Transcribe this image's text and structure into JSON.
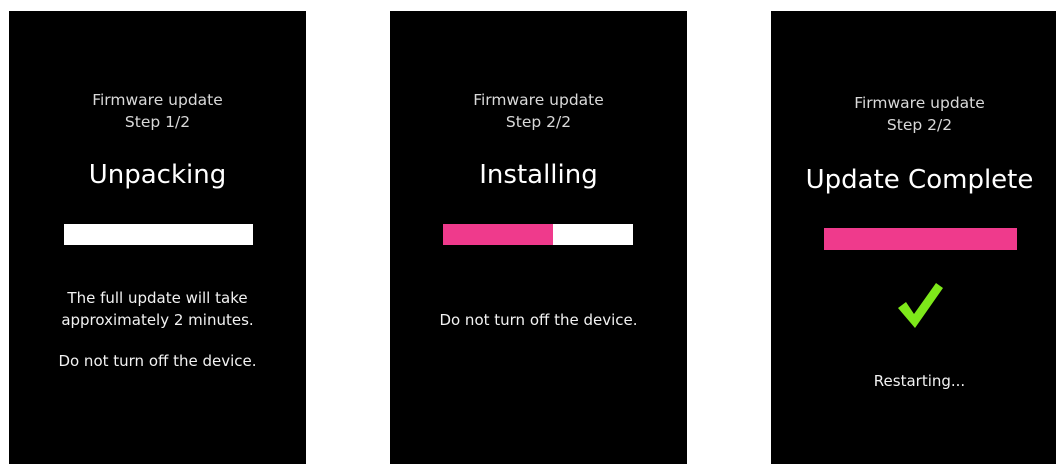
{
  "colors": {
    "screen_background": "#000000",
    "progress_track": "#ffffff",
    "progress_fill": "#ef3a8c",
    "checkmark": "#7ee81a"
  },
  "screens": [
    {
      "header": {
        "title": "Firmware update",
        "step": "Step 1/2"
      },
      "status": "Unpacking",
      "progress": 0,
      "messages": [
        "The full update will take approximately 2 minutes.",
        "Do not turn off the device."
      ]
    },
    {
      "header": {
        "title": "Firmware update",
        "step": "Step 2/2"
      },
      "status": "Installing",
      "progress": 0.58,
      "messages": [
        "Do not turn off the device."
      ]
    },
    {
      "header": {
        "title": "Firmware update",
        "step": "Step 2/2"
      },
      "status": "Update Complete",
      "progress": 1,
      "icon": "checkmark-icon",
      "messages": [
        "Restarting..."
      ]
    }
  ]
}
